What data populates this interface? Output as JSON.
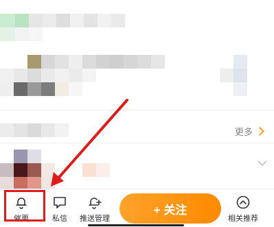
{
  "content": {
    "more_label": "更多"
  },
  "toolbar": {
    "remind_label": "催更",
    "message_label": "私信",
    "push_manage_label": "推送管理",
    "follow_label": "+ 关注",
    "related_label": "相关推荐"
  },
  "colors": {
    "accent_orange": "#ff9200",
    "highlight_red": "#e11a1a"
  },
  "icons": {
    "remind": "bell-icon",
    "message": "chat-bubble-icon",
    "push_manage": "bell-plus-icon",
    "related": "chevron-up-circle-icon",
    "more": "chevron-right-icon",
    "expand": "chevron-down-icon"
  }
}
